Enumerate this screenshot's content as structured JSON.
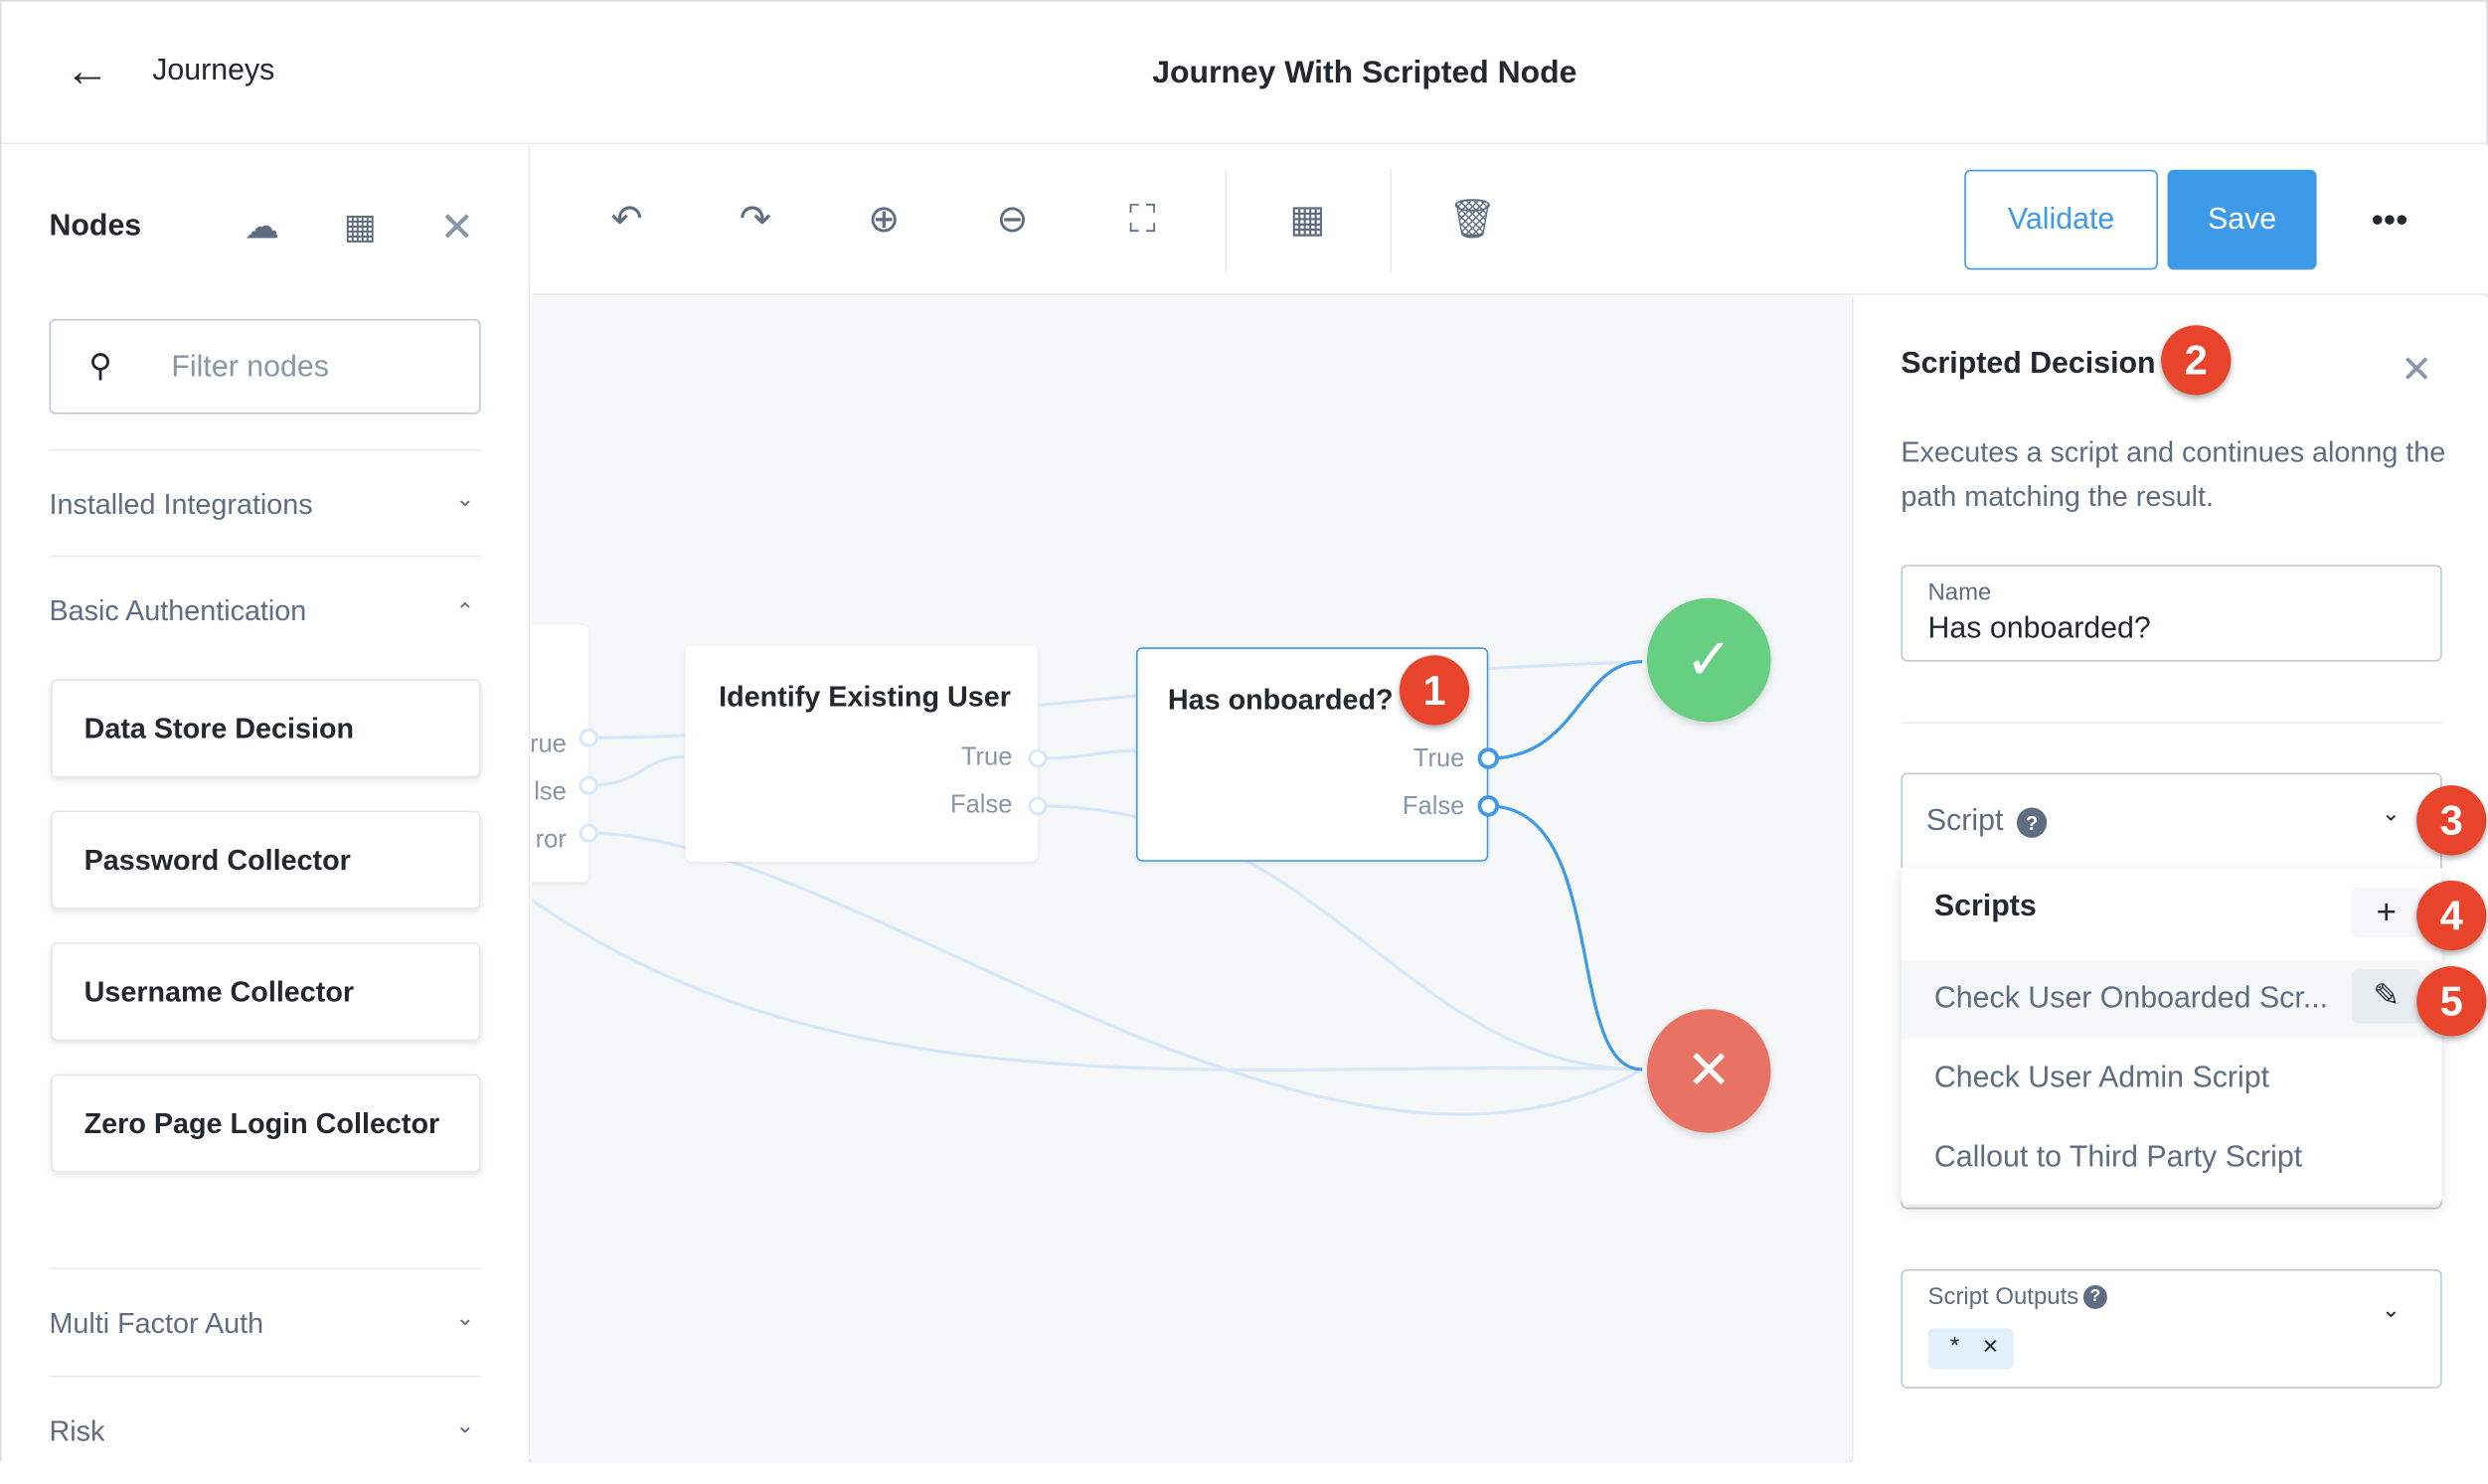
{
  "header": {
    "back_icon": "arrow-left-icon",
    "breadcrumb": "Journeys",
    "title": "Journey With Scripted Node"
  },
  "sidebar": {
    "title": "Nodes",
    "filter_placeholder": "Filter nodes",
    "categories": [
      {
        "label": "Installed Integrations",
        "expanded": false
      },
      {
        "label": "Basic Authentication",
        "expanded": true
      },
      {
        "label": "Multi Factor Auth",
        "expanded": false
      },
      {
        "label": "Risk",
        "expanded": false
      }
    ],
    "nodes": [
      "Data Store Decision",
      "Password Collector",
      "Username Collector",
      "Zero Page Login Collector"
    ]
  },
  "toolbar": {
    "validate": "Validate",
    "save": "Save"
  },
  "canvas": {
    "partial_node_outputs": [
      "rue",
      "lse",
      "ror"
    ],
    "identify_node": {
      "title": "Identify Existing User",
      "outputs": [
        "True",
        "False"
      ]
    },
    "selected_node": {
      "title": "Has onboarded?",
      "outputs": [
        "True",
        "False"
      ],
      "badge": "1"
    }
  },
  "panel": {
    "title": "Scripted Decision",
    "badge": "2",
    "description": "Executes a script and continues alonng the path matching the result.",
    "name_label": "Name",
    "name_value": "Has onboarded?",
    "script_label": "Script",
    "script_badge": "3",
    "dropdown": {
      "header": "Scripts",
      "add_badge": "4",
      "edit_badge": "5",
      "items": [
        "Check User Onboarded Scr...",
        "Check User Admin Script",
        "Callout to Third Party Script"
      ]
    },
    "outputs_label": "Script Outputs",
    "outputs_chip": "*"
  },
  "colors": {
    "accent": "#3d9ae8",
    "success": "#67cf82",
    "failure": "#e87263",
    "badge": "#e8432b"
  }
}
